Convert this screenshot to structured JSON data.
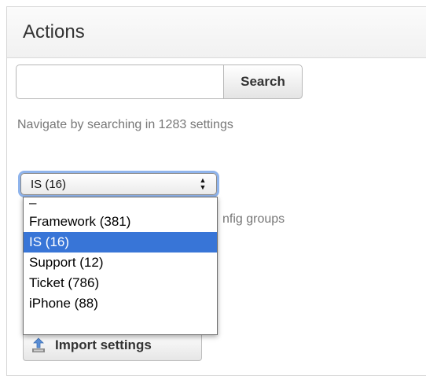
{
  "panel": {
    "title": "Actions"
  },
  "search": {
    "value": "",
    "placeholder": "",
    "button_label": "Search",
    "hint": "Navigate by searching in 1283 settings"
  },
  "group_select": {
    "selected": "IS (16)",
    "hint_fragment": "nfig groups",
    "options": [
      {
        "label": "–"
      },
      {
        "label": "Framework (381)"
      },
      {
        "label": "IS (16)"
      },
      {
        "label": "Support (12)"
      },
      {
        "label": "Ticket (786)"
      },
      {
        "label": "iPhone (88)"
      }
    ]
  },
  "import": {
    "button_label": "Import settings",
    "icon": "import-icon"
  },
  "colors": {
    "selection": "#3875d7",
    "focus_ring": "#8fb4ec",
    "header_bg": "#f1f1f1"
  }
}
